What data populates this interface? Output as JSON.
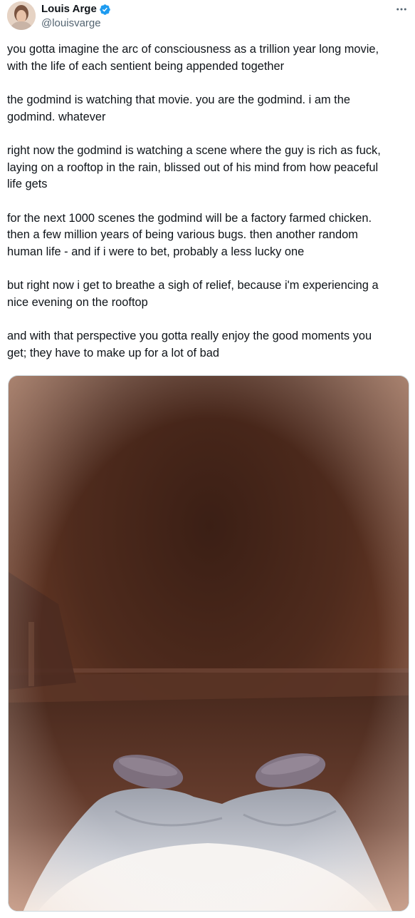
{
  "author": {
    "display_name": "Louis Arge",
    "handle": "@louisvarge",
    "verified": true,
    "verified_icon": "verified-badge-icon",
    "verified_color": "#1d9bf0"
  },
  "menu": {
    "more_icon": "more-horizontal-icon"
  },
  "tweet": {
    "paragraphs": [
      "you gotta imagine the arc of consciousness as a trillion year long movie,\nwith the life of each sentient being appended together",
      "the godmind is watching that movie. you are the godmind. i am the\ngodmind. whatever",
      "right now the godmind is watching a scene where the guy is rich as fuck,\nlaying on a rooftop in the rain, blissed out of his mind from how peaceful\nlife gets",
      "for the next 1000 scenes the godmind will be a factory farmed chicken.\nthen a few million years of being various bugs. then another random\nhuman life - and if i were to bet, probably a less lucky one",
      "but right now i get to breathe a sigh of relief, because i'm experiencing a\nnice evening on the rooftop",
      "and with that perspective you gotta really enjoy the good moments you\nget; they have to make up for a lot of bad"
    ]
  },
  "media": {
    "type": "photo",
    "subject": "rooftop-evening-photo"
  },
  "colors": {
    "text": "#0f1419",
    "secondary_text": "#536471",
    "border": "#cfd9de"
  }
}
